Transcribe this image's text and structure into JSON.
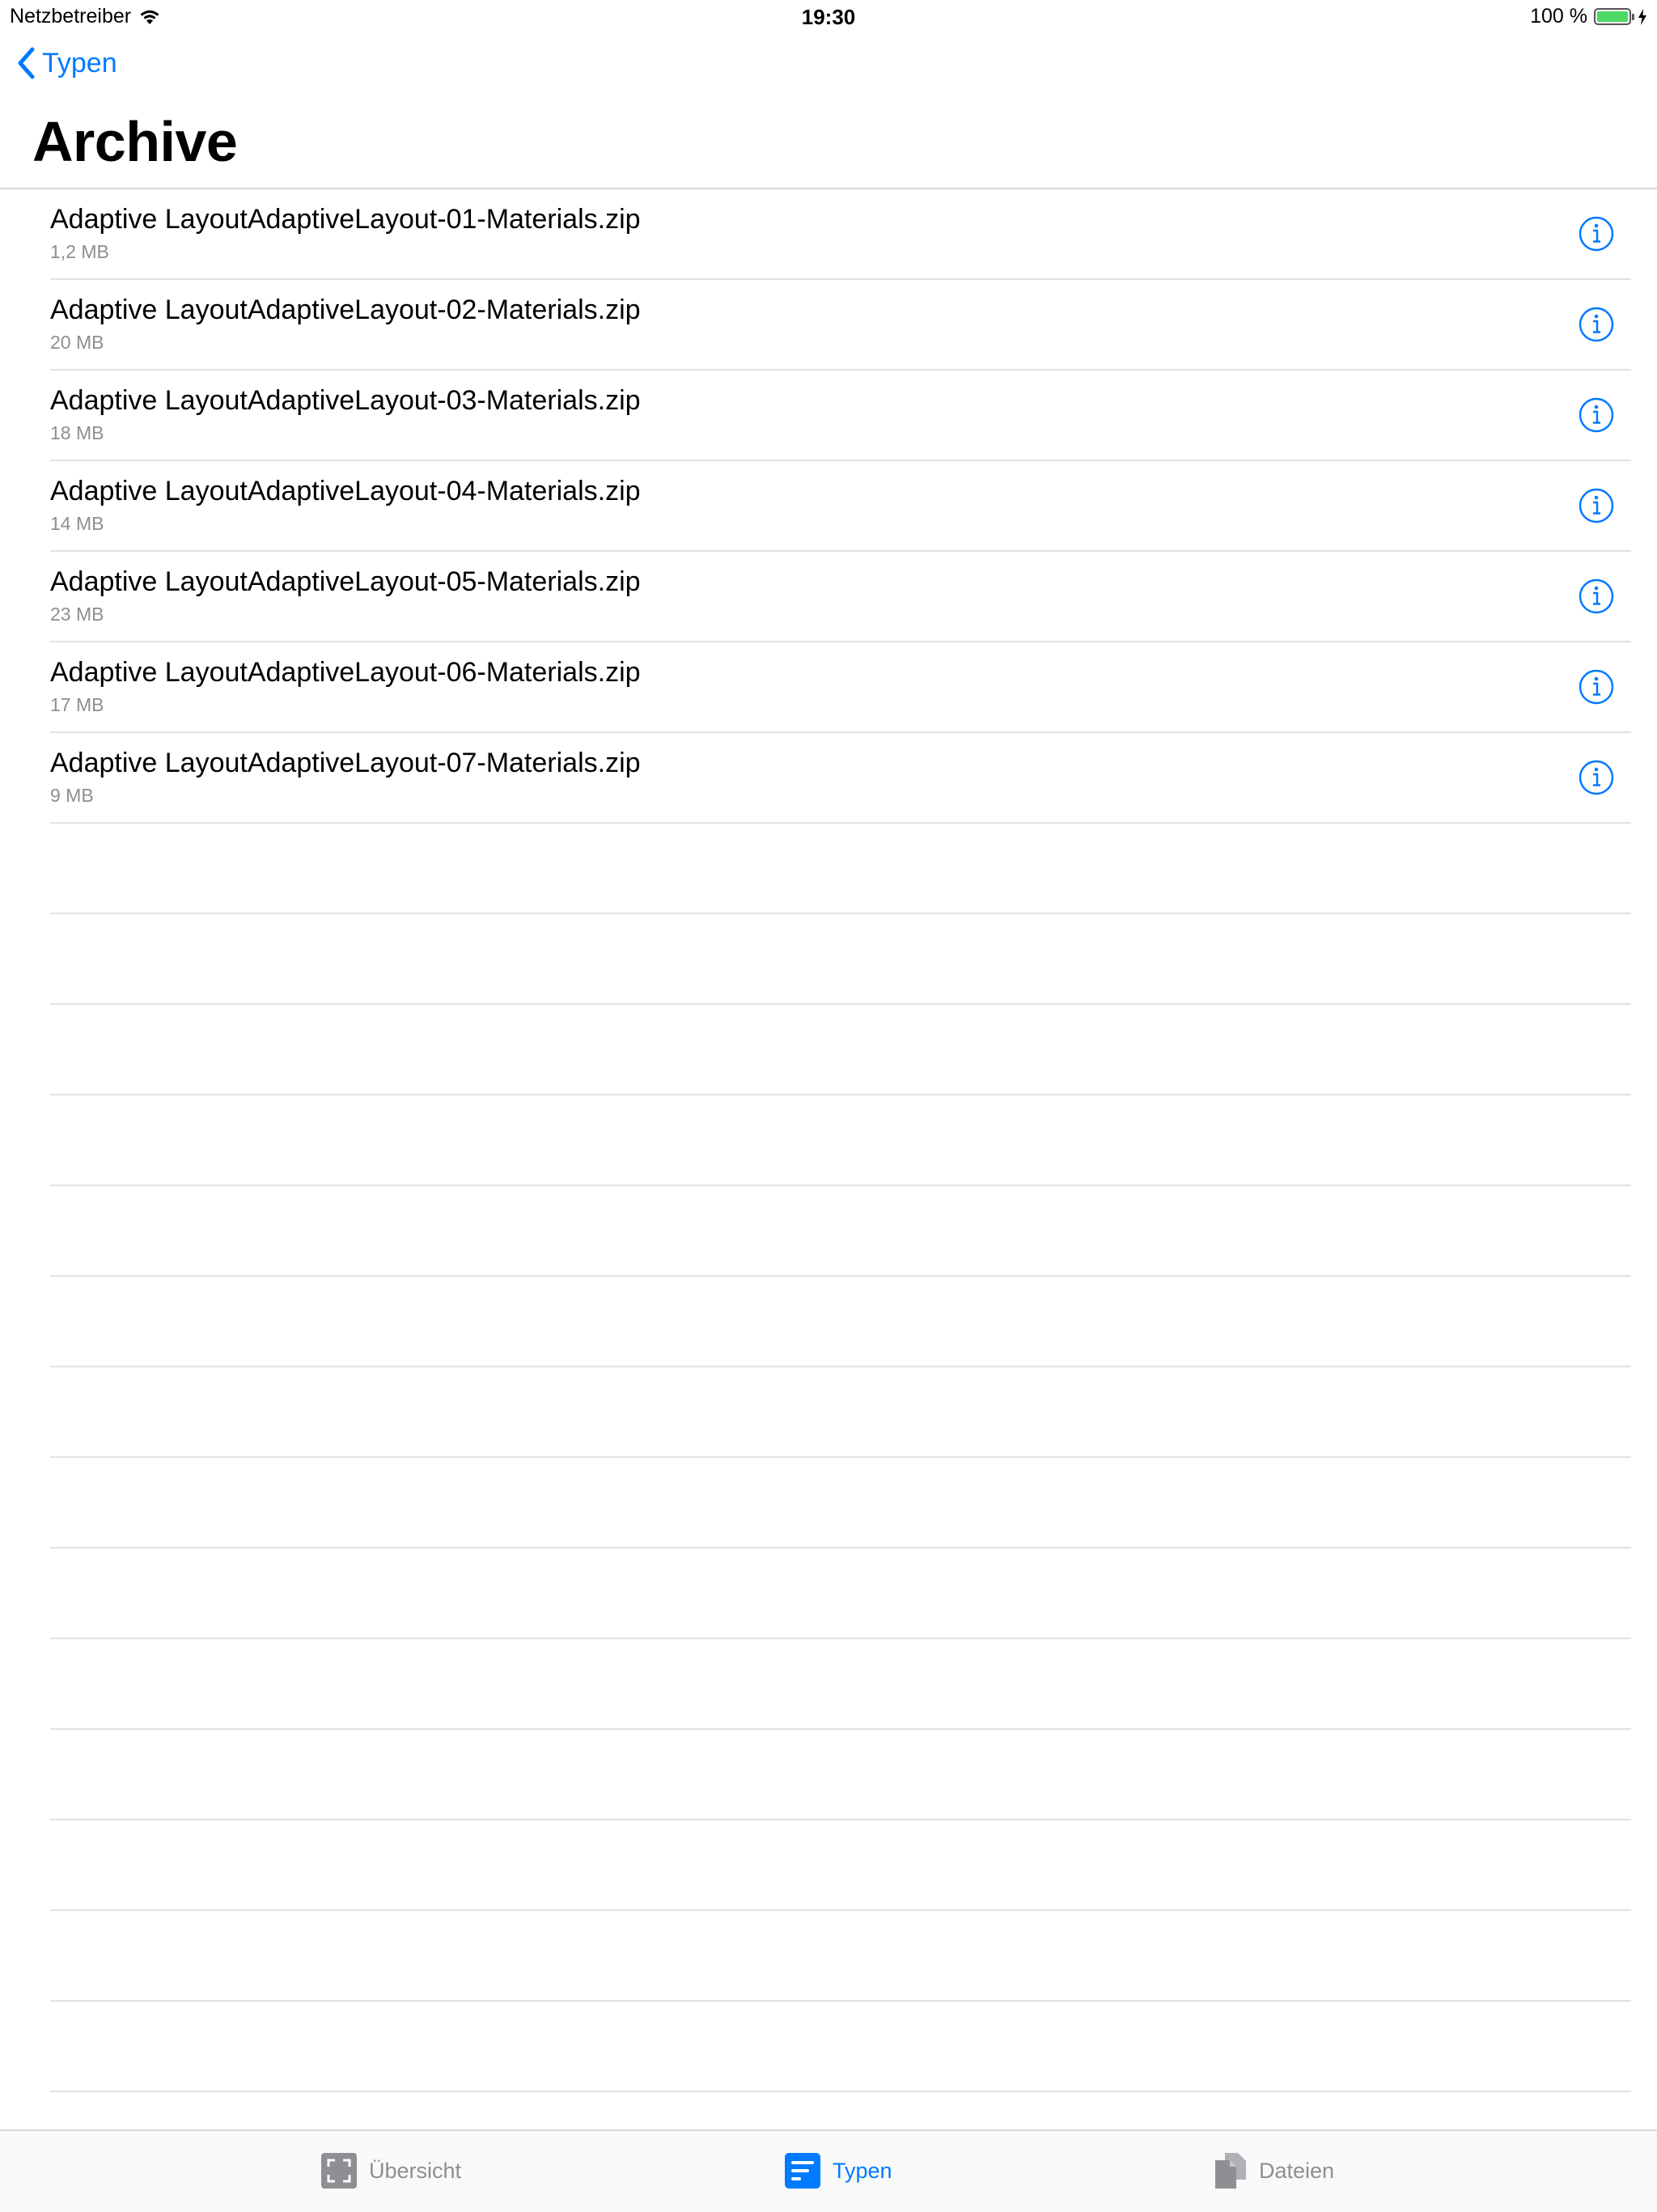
{
  "statusbar": {
    "carrier": "Netzbetreiber",
    "time": "19:30",
    "battery": "100 %"
  },
  "nav": {
    "back_label": "Typen",
    "title": "Archive"
  },
  "files": [
    {
      "name": "Adaptive LayoutAdaptiveLayout-01-Materials.zip",
      "size": "1,2 MB"
    },
    {
      "name": "Adaptive LayoutAdaptiveLayout-02-Materials.zip",
      "size": "20 MB"
    },
    {
      "name": "Adaptive LayoutAdaptiveLayout-03-Materials.zip",
      "size": "18 MB"
    },
    {
      "name": "Adaptive LayoutAdaptiveLayout-04-Materials.zip",
      "size": "14 MB"
    },
    {
      "name": "Adaptive LayoutAdaptiveLayout-05-Materials.zip",
      "size": "23 MB"
    },
    {
      "name": "Adaptive LayoutAdaptiveLayout-06-Materials.zip",
      "size": "17 MB"
    },
    {
      "name": "Adaptive LayoutAdaptiveLayout-07-Materials.zip",
      "size": "9 MB"
    }
  ],
  "tabbar": {
    "tabs": [
      {
        "label": "Übersicht",
        "icon": "overview-icon",
        "active": false
      },
      {
        "label": "Typen",
        "icon": "types-icon",
        "active": true
      },
      {
        "label": "Dateien",
        "icon": "files-icon",
        "active": false
      }
    ]
  },
  "colors": {
    "accent": "#007aff",
    "secondary_text": "#8e8e93",
    "battery": "#4cd964"
  }
}
